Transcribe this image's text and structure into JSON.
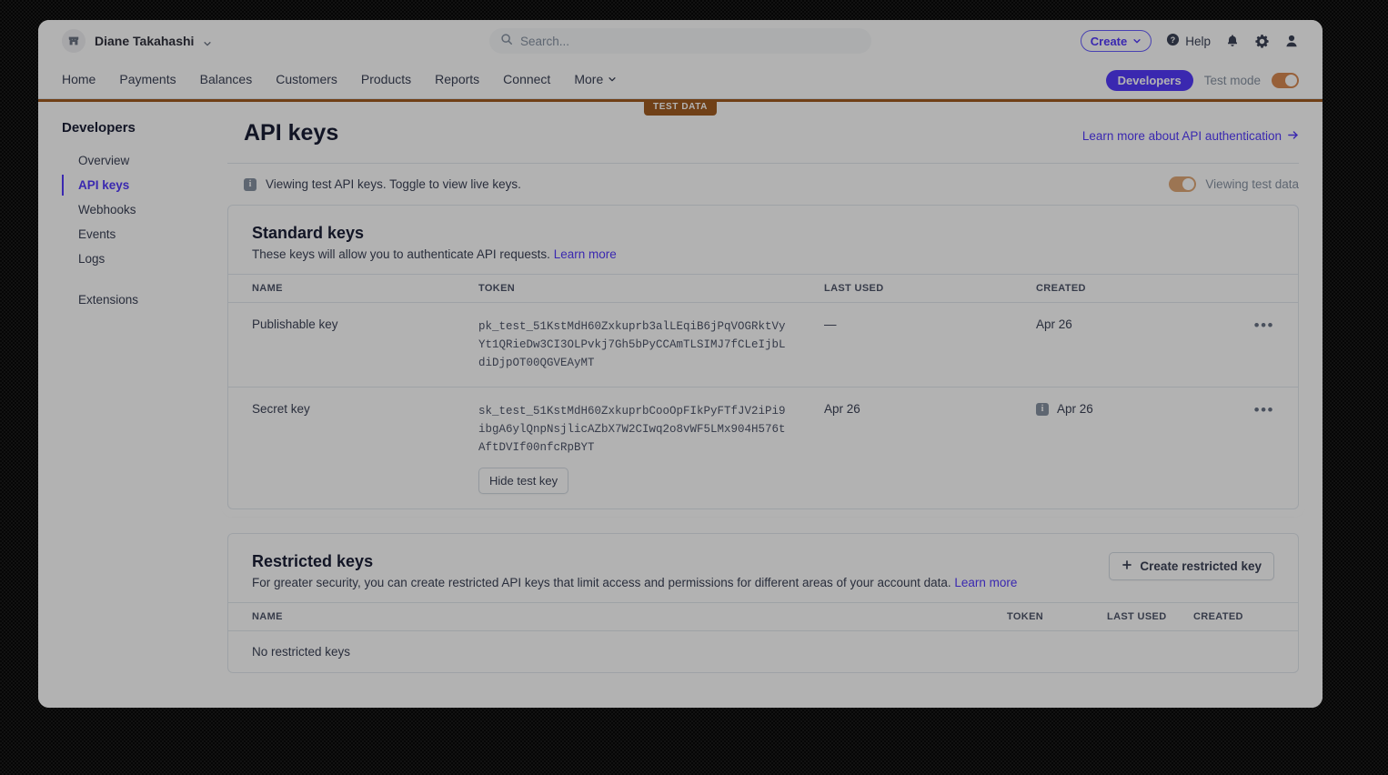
{
  "topbar": {
    "account_name": "Diane Takahashi",
    "account_icon": "store-icon",
    "account_chevron": "chevron-down-icon",
    "search_placeholder": "Search...",
    "search_value": "",
    "search_icon": "search-icon",
    "create_label": "Create",
    "help_label": "Help",
    "help_icon": "question-circle-icon",
    "notifications_icon": "bell-icon",
    "settings_icon": "gear-icon",
    "profile_icon": "user-icon"
  },
  "nav": {
    "items": [
      {
        "label": "Home",
        "active": false
      },
      {
        "label": "Payments",
        "active": false
      },
      {
        "label": "Balances",
        "active": false
      },
      {
        "label": "Customers",
        "active": false
      },
      {
        "label": "Products",
        "active": false
      },
      {
        "label": "Reports",
        "active": false
      },
      {
        "label": "Connect",
        "active": false
      },
      {
        "label": "More",
        "active": false,
        "chevron": "chevron-down-icon"
      }
    ],
    "developers_label": "Developers",
    "test_mode_label": "Test mode",
    "test_mode_on": true,
    "test_data_badge": "TEST DATA"
  },
  "sidebar": {
    "title": "Developers",
    "items": [
      {
        "label": "Overview",
        "active": false
      },
      {
        "label": "API keys",
        "active": true
      },
      {
        "label": "Webhooks",
        "active": false
      },
      {
        "label": "Events",
        "active": false
      },
      {
        "label": "Logs",
        "active": false
      },
      {
        "label": "Extensions",
        "active": false,
        "separated": true
      }
    ]
  },
  "page": {
    "title": "API keys",
    "head_link": "Learn more about API authentication",
    "head_link_arrow": "arrow-right-icon",
    "notice_text": "Viewing test API keys. Toggle to view live keys.",
    "notice_icon": "info-icon",
    "notice_toggle_label": "Viewing test data",
    "notice_toggle_on": true
  },
  "standard_keys": {
    "title": "Standard keys",
    "subtitle": "These keys will allow you to authenticate API requests.",
    "subtitle_link": "Learn more",
    "columns": [
      "NAME",
      "TOKEN",
      "LAST USED",
      "CREATED"
    ],
    "rows": [
      {
        "name": "Publishable key",
        "token": "pk_test_51KstMdH60Zxkuprb3alLEqiB6jPqVOGRktVyYt1QRieDw3CI3OLPvkj7Gh5bPyCCAmTLSIMJ7fCLeIjbLdiDjpOT00QGVEAyMT",
        "last_used": "—",
        "created": "Apr 26",
        "created_has_info_icon": false,
        "action_icon": "overflow-menu-icon",
        "reveal_button": null
      },
      {
        "name": "Secret key",
        "token": "sk_test_51KstMdH60ZxkuprbCooOpFIkPyFTfJV2iPi9ibgA6ylQnpNsjlicAZbX7W2CIwq2o8vWF5LMx904H576tAftDVIf00nfcRpBYT",
        "last_used": "Apr 26",
        "created": "Apr 26",
        "created_has_info_icon": true,
        "action_icon": "overflow-menu-icon",
        "reveal_button": "Hide test key"
      }
    ]
  },
  "restricted_keys": {
    "title": "Restricted keys",
    "subtitle": "For greater security, you can create restricted API keys that limit access and permissions for different areas of your account data.",
    "subtitle_link": "Learn more",
    "create_button": "Create restricted key",
    "create_button_icon": "plus-icon",
    "columns": [
      "NAME",
      "TOKEN",
      "LAST USED",
      "CREATED"
    ],
    "empty_message": "No restricted keys"
  },
  "colors": {
    "accent": "#533afd",
    "test_mode": "#a15c21",
    "border": "#e3e8ee",
    "text": "#3c4257"
  }
}
